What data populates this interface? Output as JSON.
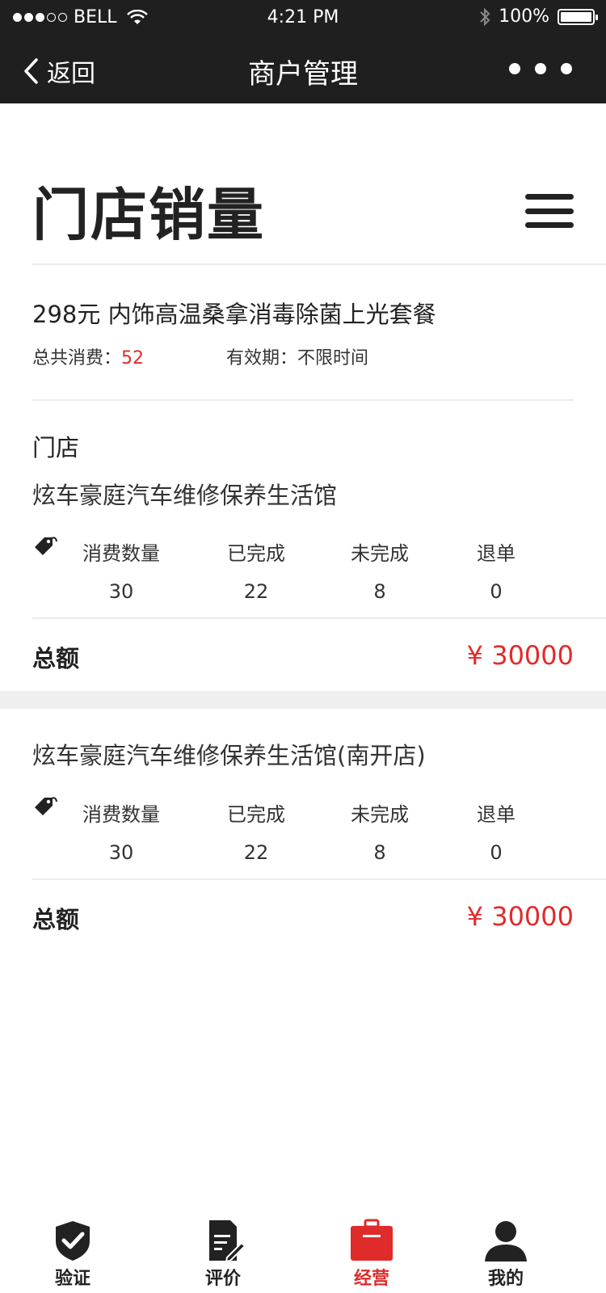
{
  "status_bar": {
    "carrier": "BELL",
    "time": "4:21 PM",
    "battery": "100%"
  },
  "nav": {
    "back_label": "返回",
    "title": "商户管理"
  },
  "page": {
    "heading": "门店销量"
  },
  "package": {
    "name": "298元 内饰高温桑拿消毒除菌上光套餐",
    "total_label": "总共消费：",
    "total_value": "52",
    "validity": "有效期：不限时间"
  },
  "stores_label": "门店",
  "stores": [
    {
      "name": "炫车豪庭汽车维修保养生活馆",
      "stats": [
        {
          "label": "消费数量",
          "value": "30"
        },
        {
          "label": "已完成",
          "value": "22"
        },
        {
          "label": "未完成",
          "value": "8"
        },
        {
          "label": "退单",
          "value": "0"
        }
      ],
      "total_label": "总额",
      "total_value": "¥ 30000"
    },
    {
      "name": "炫车豪庭汽车维修保养生活馆(南开店)",
      "stats": [
        {
          "label": "消费数量",
          "value": "30"
        },
        {
          "label": "已完成",
          "value": "22"
        },
        {
          "label": "未完成",
          "value": "8"
        },
        {
          "label": "退单",
          "value": "0"
        }
      ],
      "total_label": "总额",
      "total_value": "¥ 30000"
    }
  ],
  "tabbar": [
    {
      "label": "验证",
      "icon": "shield-check-icon"
    },
    {
      "label": "评价",
      "icon": "edit-document-icon"
    },
    {
      "label": "经营",
      "icon": "briefcase-icon",
      "active": true
    },
    {
      "label": "我的",
      "icon": "user-icon"
    }
  ],
  "colors": {
    "accent": "#e02b2b",
    "nav_bg": "#1f1f1f",
    "divider": "#efefef"
  }
}
